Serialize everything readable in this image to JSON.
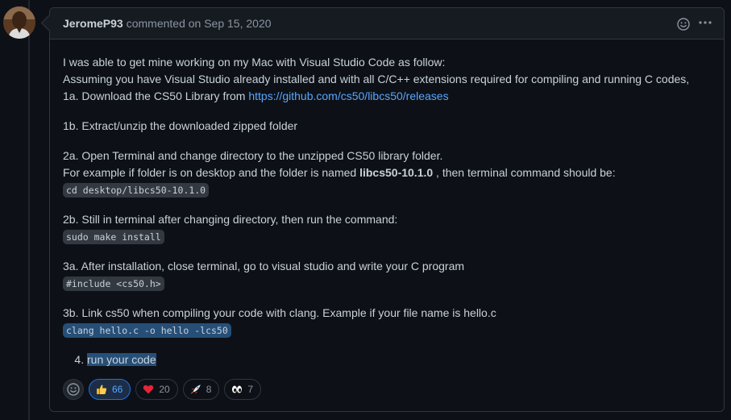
{
  "comment": {
    "author": "JeromeP93",
    "meta": "commented on Sep 15, 2020",
    "body": {
      "p1_line1": "I was able to get mine working on my Mac with Visual Studio Code as follow:",
      "p1_line2": "Assuming you have Visual Studio already installed and with all C/C++ extensions required for compiling and running C codes,",
      "p1_line3_prefix": "1a. Download the CS50 Library from ",
      "p1_link": "https://github.com/cs50/libcs50/releases",
      "p2": "1b. Extract/unzip the downloaded zipped folder",
      "p3_line1": "2a. Open Terminal and change directory to the unzipped CS50 library folder.",
      "p3_line2_prefix": "For example if folder is on desktop and the folder is named ",
      "p3_bold": "libcs50-10.1.0",
      "p3_line2_suffix": " , then terminal command should be:",
      "p3_code": "cd desktop/libcs50-10.1.0",
      "p4_line1": "2b. Still in terminal after changing directory, then run the command:",
      "p4_code": "sudo make install",
      "p5_line1": "3a. After installation, close terminal, go to visual studio and write your C program",
      "p5_code": "#include <cs50.h>",
      "p6_line1": "3b. Link cs50 when compiling your code with clang. Example if your file name is hello.c",
      "p6_code": "clang hello.c -o hello -lcs50",
      "list_item_4": "run your code"
    },
    "reactions": [
      {
        "icon": "thumbs-up-icon",
        "count": "66",
        "active": true
      },
      {
        "icon": "heart-icon",
        "count": "20",
        "active": false
      },
      {
        "icon": "rocket-icon",
        "count": "8",
        "active": false
      },
      {
        "icon": "eyes-icon",
        "count": "7",
        "active": false
      }
    ]
  },
  "colors": {
    "background": "#0d1117",
    "header": "#161b22",
    "border": "#30363d",
    "link": "#58a6ff",
    "selection": "#264f78"
  }
}
